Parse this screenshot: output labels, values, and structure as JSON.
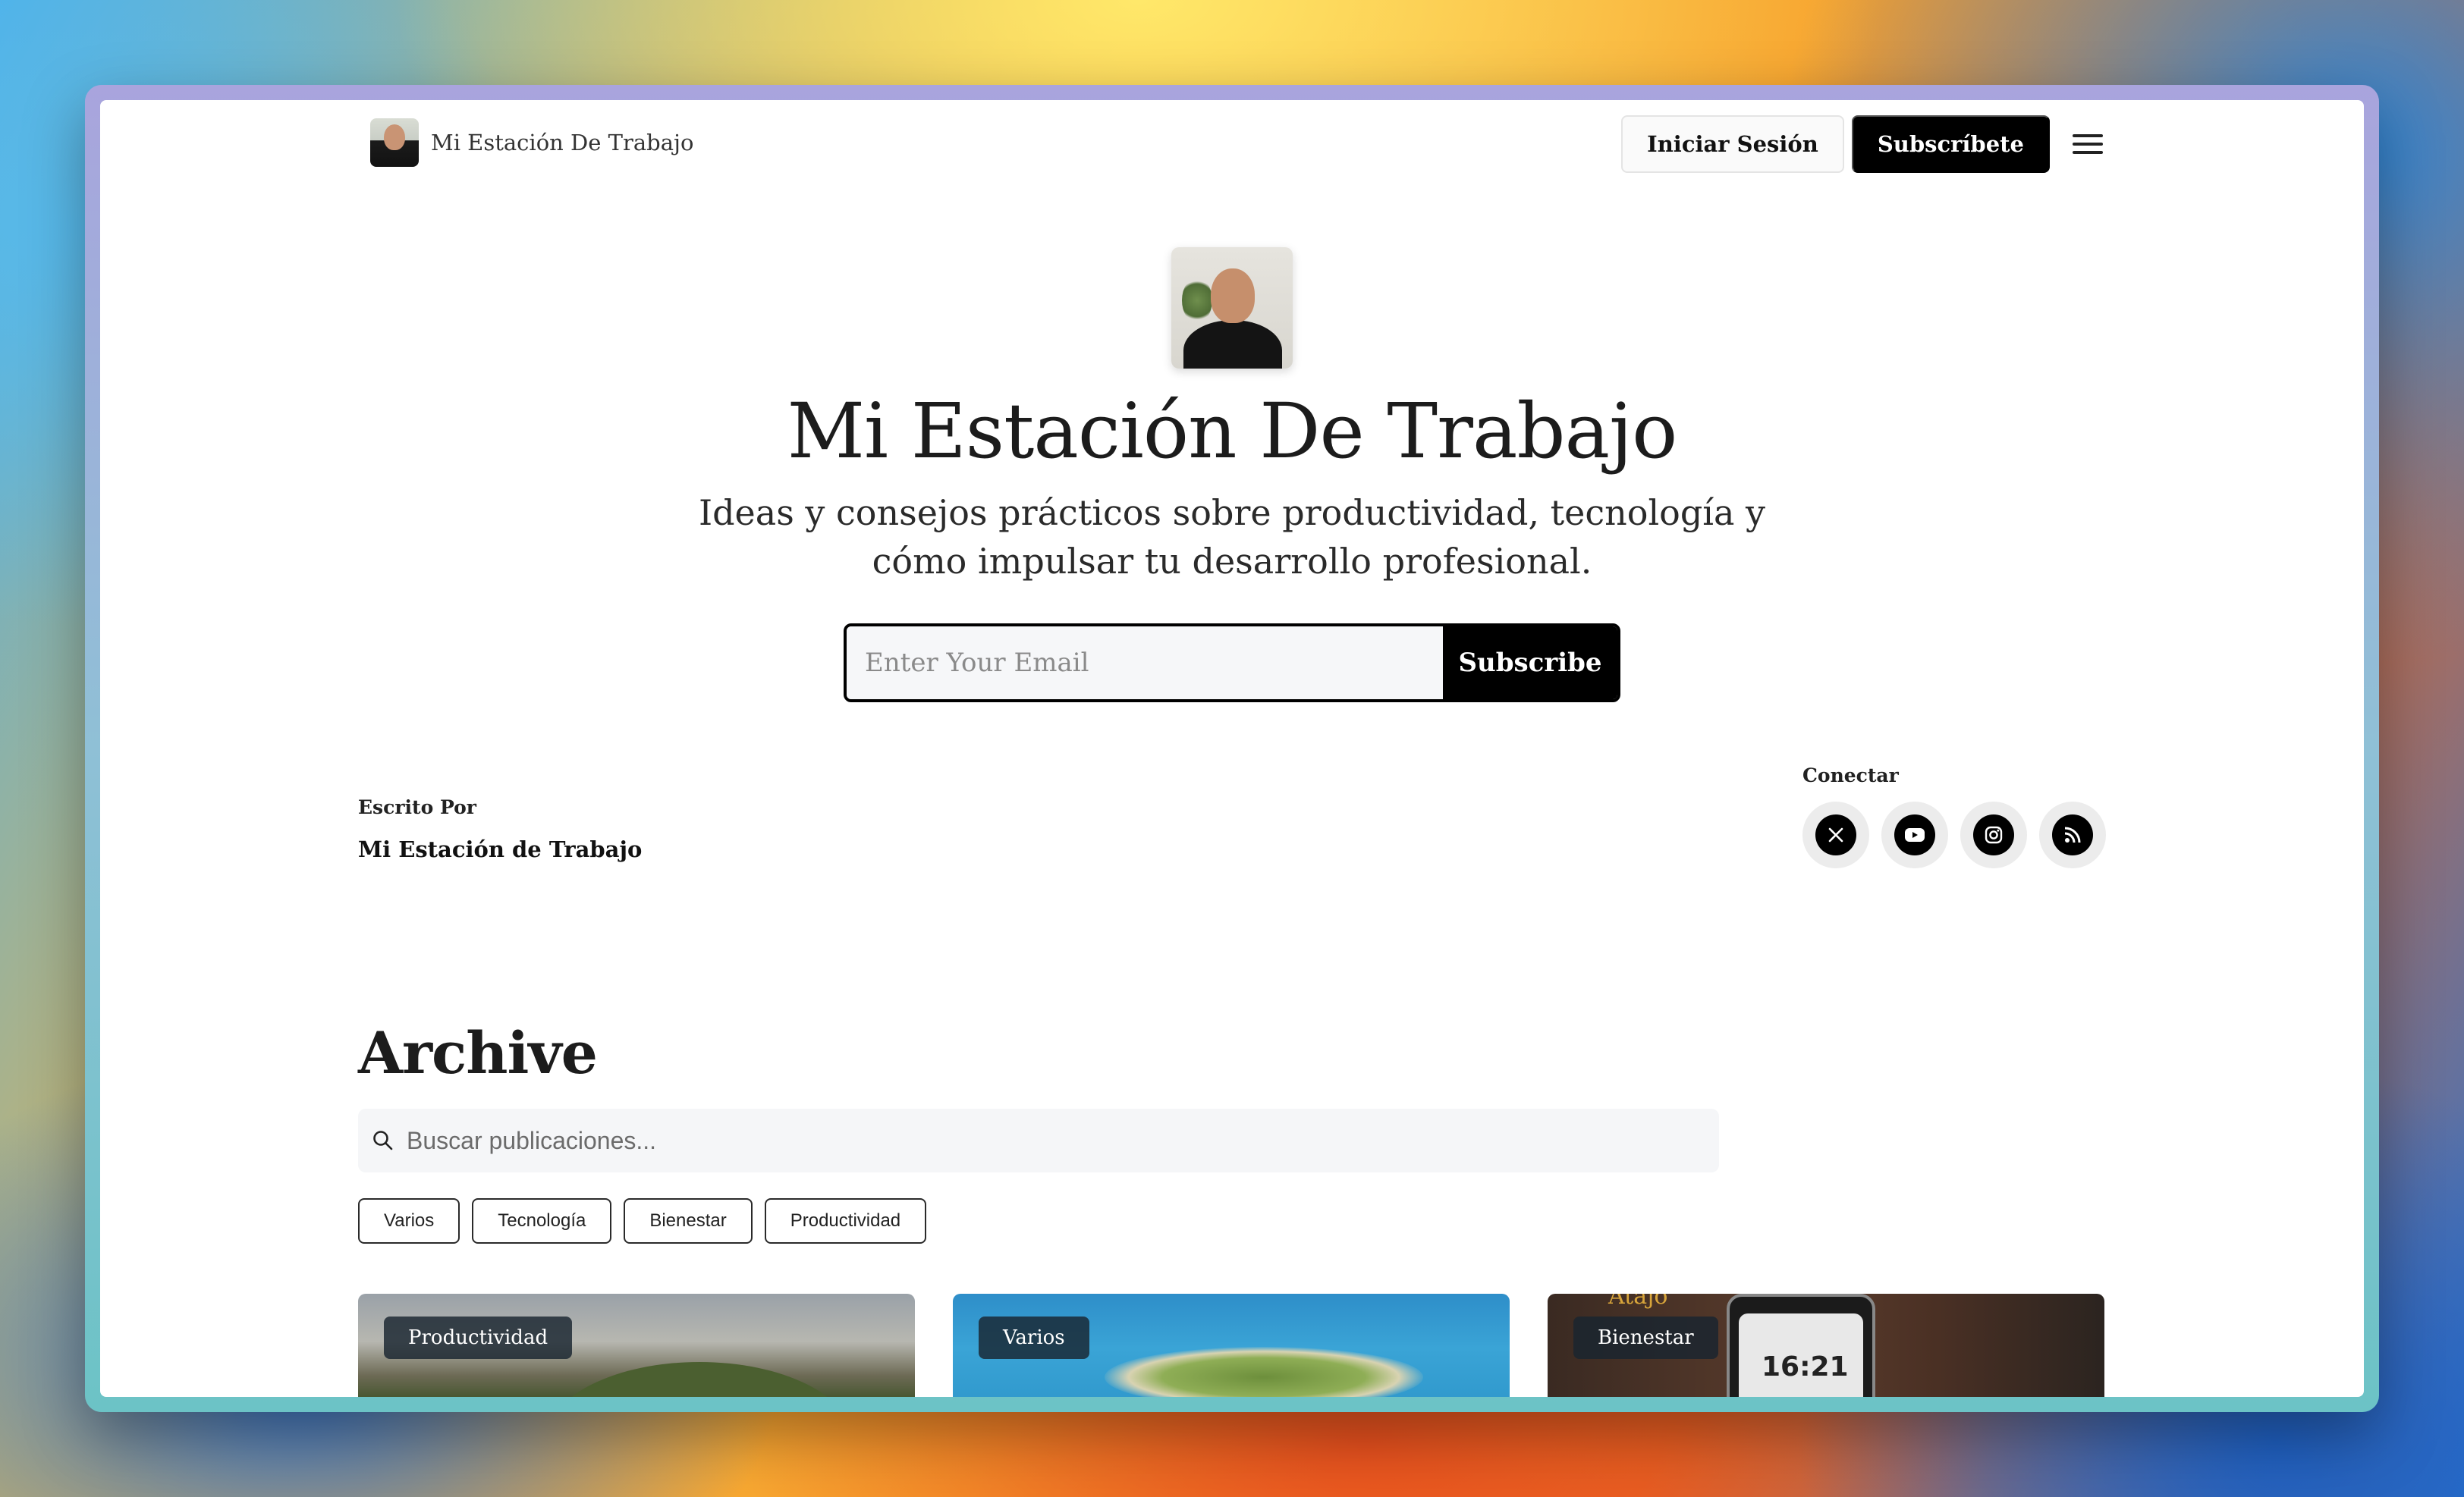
{
  "header": {
    "brand_name": "Mi Estación De Trabajo",
    "login_label": "Iniciar Sesión",
    "subscribe_label": "Subscríbete"
  },
  "hero": {
    "title": "Mi Estación De Trabajo",
    "subtitle_line1": "Ideas y consejos prácticos sobre productividad, tecnología y",
    "subtitle_line2": "cómo impulsar tu desarrollo profesional.",
    "email_placeholder": "Enter Your Email",
    "subscribe_button": "Subscribe"
  },
  "author": {
    "label": "Escrito Por",
    "name": "Mi Estación de Trabajo"
  },
  "connect": {
    "label": "Conectar",
    "icons": [
      "x-icon",
      "youtube-icon",
      "instagram-icon",
      "rss-icon"
    ]
  },
  "archive": {
    "title": "Archive",
    "search_placeholder": "Buscar publicaciones...",
    "filters": [
      "Varios",
      "Tecnología",
      "Bienestar",
      "Productividad"
    ],
    "cards": [
      {
        "tag": "Productividad"
      },
      {
        "tag": "Varios"
      },
      {
        "tag": "Bienestar",
        "image_text": "Atajo",
        "clock": "16:21"
      }
    ]
  },
  "colors": {
    "accent": "#000000",
    "background": "#ffffff"
  }
}
